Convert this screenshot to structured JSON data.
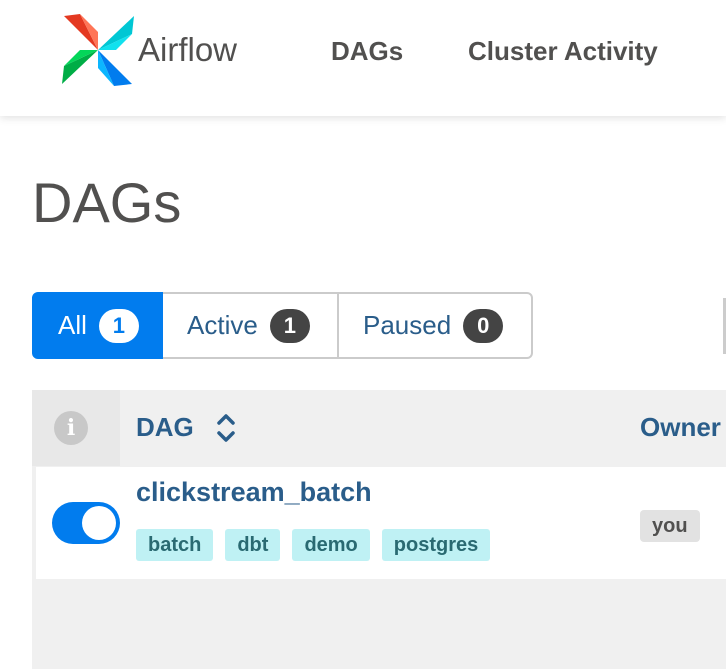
{
  "brand": {
    "name": "Airflow",
    "logo_icon": "airflow-pinwheel-icon"
  },
  "nav": {
    "dags_label": "DAGs",
    "cluster_label": "Cluster Activity"
  },
  "page": {
    "title": "DAGs"
  },
  "filters": {
    "all": {
      "label": "All",
      "count": "1"
    },
    "active": {
      "label": "Active",
      "count": "1"
    },
    "paused": {
      "label": "Paused",
      "count": "0"
    }
  },
  "table": {
    "info_icon": "info-icon",
    "headers": {
      "dag": "DAG",
      "owner": "Owner"
    },
    "rows": [
      {
        "dag_id": "clickstream_batch",
        "enabled": true,
        "tags": [
          "batch",
          "dbt",
          "demo",
          "postgres"
        ],
        "owner": "you"
      }
    ]
  },
  "colors": {
    "accent": "#017cee",
    "tag_bg": "#bff1f4",
    "text": "#51504f"
  }
}
